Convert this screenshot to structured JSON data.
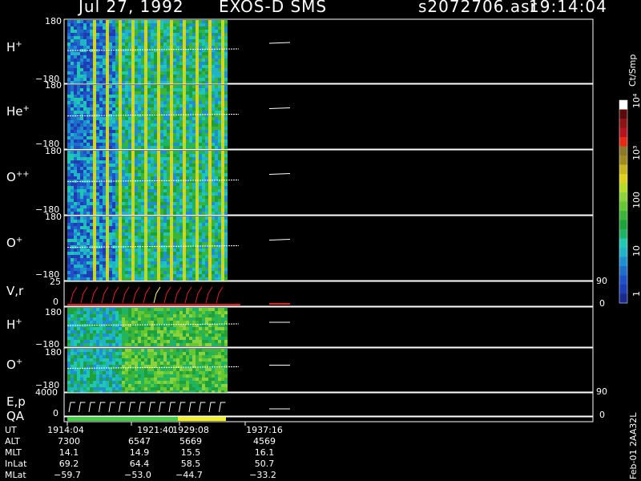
{
  "header": {
    "date": "Jul 27, 1992",
    "instrument": "EXOS-D SMS",
    "file": "s2072706.asr",
    "time": "19:14:04"
  },
  "panels": [
    {
      "id": "hplus1",
      "label_main": "H",
      "label_sup": "+",
      "ytop": "180",
      "ybot": "−180"
    },
    {
      "id": "heplus",
      "label_main": "He",
      "label_sup": "+",
      "ytop": "180",
      "ybot": "−180"
    },
    {
      "id": "oplusplus",
      "label_main": "O",
      "label_sup": "++",
      "ytop": "180",
      "ybot": "−180"
    },
    {
      "id": "oplus1",
      "label_main": "O",
      "label_sup": "+",
      "ytop": "180",
      "ybot": "−180"
    },
    {
      "id": "vr",
      "label_main": "V,r",
      "label_sup": "",
      "ytop": "25",
      "ybot": "0",
      "rtop": "90",
      "rbot": "0"
    },
    {
      "id": "hplus2",
      "label_main": "H",
      "label_sup": "+",
      "ytop": "180",
      "ybot": "−180"
    },
    {
      "id": "oplus2",
      "label_main": "O",
      "label_sup": "+",
      "ytop": "180",
      "ybot": "−180"
    },
    {
      "id": "ep",
      "label_main": "E,p",
      "label_sup": "",
      "ytop": "4000",
      "ybot": "0",
      "rtop": "90",
      "rbot": "0"
    }
  ],
  "qa_label": "QA",
  "colorbar": {
    "unit": "Ct/Smp",
    "ticks": [
      {
        "label": "1",
        "value": 1
      },
      {
        "label": "10",
        "value": 10
      },
      {
        "label": "100",
        "value": 100
      },
      {
        "label": "10³",
        "value": 1000
      },
      {
        "label": "10⁴",
        "value": 10000
      }
    ],
    "colors": [
      "#1a2a8c",
      "#1e3cb4",
      "#2050c8",
      "#1e6ec8",
      "#1e90d2",
      "#20b4c8",
      "#20c8b4",
      "#1eb464",
      "#1ea03c",
      "#3cb43c",
      "#64c832",
      "#8cd23c",
      "#b4dc28",
      "#dcd21e",
      "#c8b41e",
      "#a08c1e",
      "#8c7828",
      "#e62814",
      "#b4141e",
      "#8c1414",
      "#5a0a0a",
      "#ffffff"
    ]
  },
  "footer_label": "Feb-01 2AA32L",
  "orbit_table": {
    "rows": [
      {
        "name": "UT",
        "values": [
          "1914:04",
          "1921:40",
          "1929:08",
          "1937:16"
        ]
      },
      {
        "name": "ALT",
        "values": [
          "7300",
          "6547",
          "5669",
          "4569"
        ]
      },
      {
        "name": "MLT",
        "values": [
          "14.1",
          "14.9",
          "15.5",
          "16.1"
        ]
      },
      {
        "name": "InLat",
        "values": [
          "69.2",
          "64.4",
          "58.5",
          "50.7"
        ]
      },
      {
        "name": "MLat",
        "values": [
          "−59.7",
          "−53.0",
          "−44.7",
          "−33.2"
        ]
      }
    ]
  },
  "chart_data": {
    "type": "heatmap",
    "title": "Jul 27, 1992   EXOS-D SMS",
    "x": [
      "1914:04",
      "1921:40",
      "1929:08",
      "1937:16"
    ],
    "xlabel": "UT",
    "series": [
      {
        "name": "H+",
        "ylim": [
          -180,
          180
        ]
      },
      {
        "name": "He+",
        "ylim": [
          -180,
          180
        ]
      },
      {
        "name": "O++",
        "ylim": [
          -180,
          180
        ]
      },
      {
        "name": "O+",
        "ylim": [
          -180,
          180
        ]
      },
      {
        "name": "V,r",
        "ylim": [
          0,
          25
        ],
        "right_ylim": [
          0,
          90
        ]
      },
      {
        "name": "H+",
        "ylim": [
          -180,
          180
        ]
      },
      {
        "name": "O+",
        "ylim": [
          -180,
          180
        ]
      },
      {
        "name": "E,p",
        "ylim": [
          0,
          4000
        ],
        "right_ylim": [
          0,
          90
        ]
      }
    ],
    "colorbar_ticks": [
      "1",
      "10",
      "100",
      "10³",
      "10⁴"
    ],
    "colorbar_label": "Ct/Smp"
  }
}
